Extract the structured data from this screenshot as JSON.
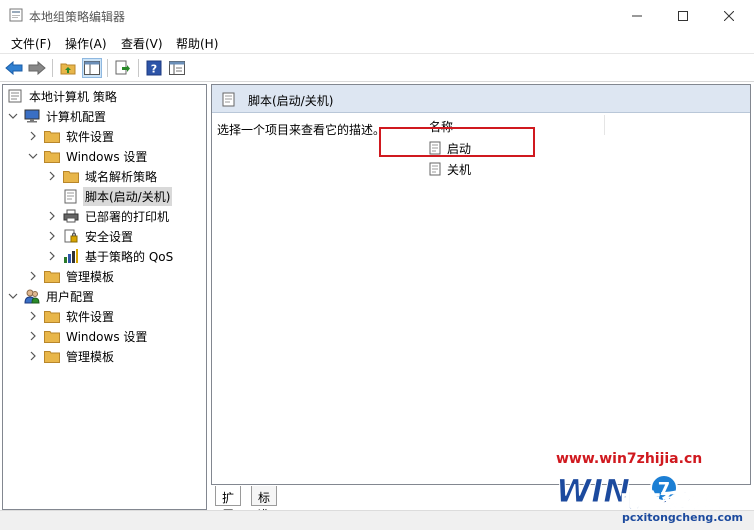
{
  "window": {
    "title": "本地组策略编辑器"
  },
  "menu": [
    {
      "label": "文件(F)"
    },
    {
      "label": "操作(A)"
    },
    {
      "label": "查看(V)"
    },
    {
      "label": "帮助(H)"
    }
  ],
  "toolbar": {
    "icons": [
      "back-arrow-icon",
      "forward-arrow-icon",
      "up-folder-icon",
      "show-hide-tree-icon",
      "export-list-icon",
      "help-icon",
      "properties-icon"
    ]
  },
  "tree": {
    "root": "本地计算机 策略",
    "computer_config": "计算机配置",
    "cc_software": "软件设置",
    "cc_windows": "Windows 设置",
    "cc_dns": "域名解析策略",
    "cc_scripts": "脚本(启动/关机)",
    "cc_printers": "已部署的打印机",
    "cc_security": "安全设置",
    "cc_qos": "基于策略的 QoS",
    "cc_admin": "管理模板",
    "user_config": "用户配置",
    "uc_software": "软件设置",
    "uc_windows": "Windows 设置",
    "uc_admin": "管理模板"
  },
  "right": {
    "header": "脚本(启动/关机)",
    "description": "选择一个项目来查看它的描述。",
    "column_name": "名称",
    "items": [
      {
        "label": "启动"
      },
      {
        "label": "关机"
      }
    ]
  },
  "tabs": [
    {
      "label": "扩展",
      "active": true
    },
    {
      "label": "标准",
      "active": false
    }
  ],
  "watermark": {
    "url": "www.win7zhijia.cn",
    "logo": "WIN7 电脑系统城",
    "sub": "pcxitongcheng.com"
  },
  "colors": {
    "highlight": "#d0191f",
    "header_bg": "#dde6f2",
    "selected_bg": "#d9d9d9",
    "folder": "#e8b64a"
  }
}
